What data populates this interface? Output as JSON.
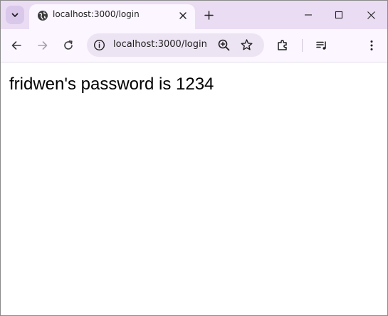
{
  "browser": {
    "tab": {
      "title": "localhost:3000/login",
      "favicon": "globe-icon"
    },
    "address_bar": {
      "url": "localhost:3000/login"
    },
    "colors": {
      "tabstrip_bg": "#e9dcf3",
      "toolbar_bg": "#fbf6ff",
      "omnibox_bg": "#ede4f3"
    }
  },
  "page": {
    "message": "fridwen's password is 1234"
  }
}
